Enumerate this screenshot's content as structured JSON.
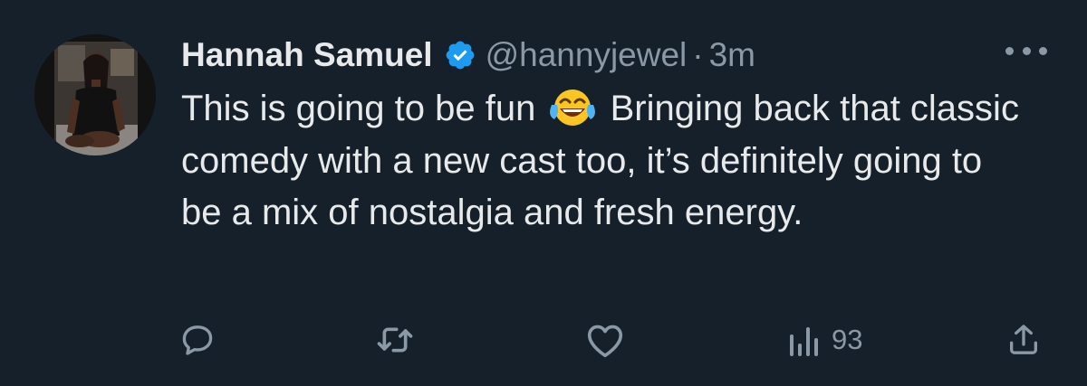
{
  "tweet": {
    "author_name": "Hannah Samuel",
    "handle": "@hannyjewel",
    "separator": "·",
    "time": "3m",
    "text_before_emoji": "This is going to be fun",
    "emoji": "face-with-tears-of-joy",
    "text_after_emoji": "Bringing back that classic comedy with a new cast too, it’s definitely going to be a mix of nostalgia and fresh energy.",
    "actions": {
      "reply": "reply-icon",
      "retweet": "retweet-icon",
      "like": "heart-icon",
      "views_count": "93",
      "share": "share-icon"
    }
  },
  "colors": {
    "background": "#15202b",
    "primary_text": "#e7e9ea",
    "secondary_text": "#8b98a5",
    "verified_badge": "#1d9bf0"
  }
}
